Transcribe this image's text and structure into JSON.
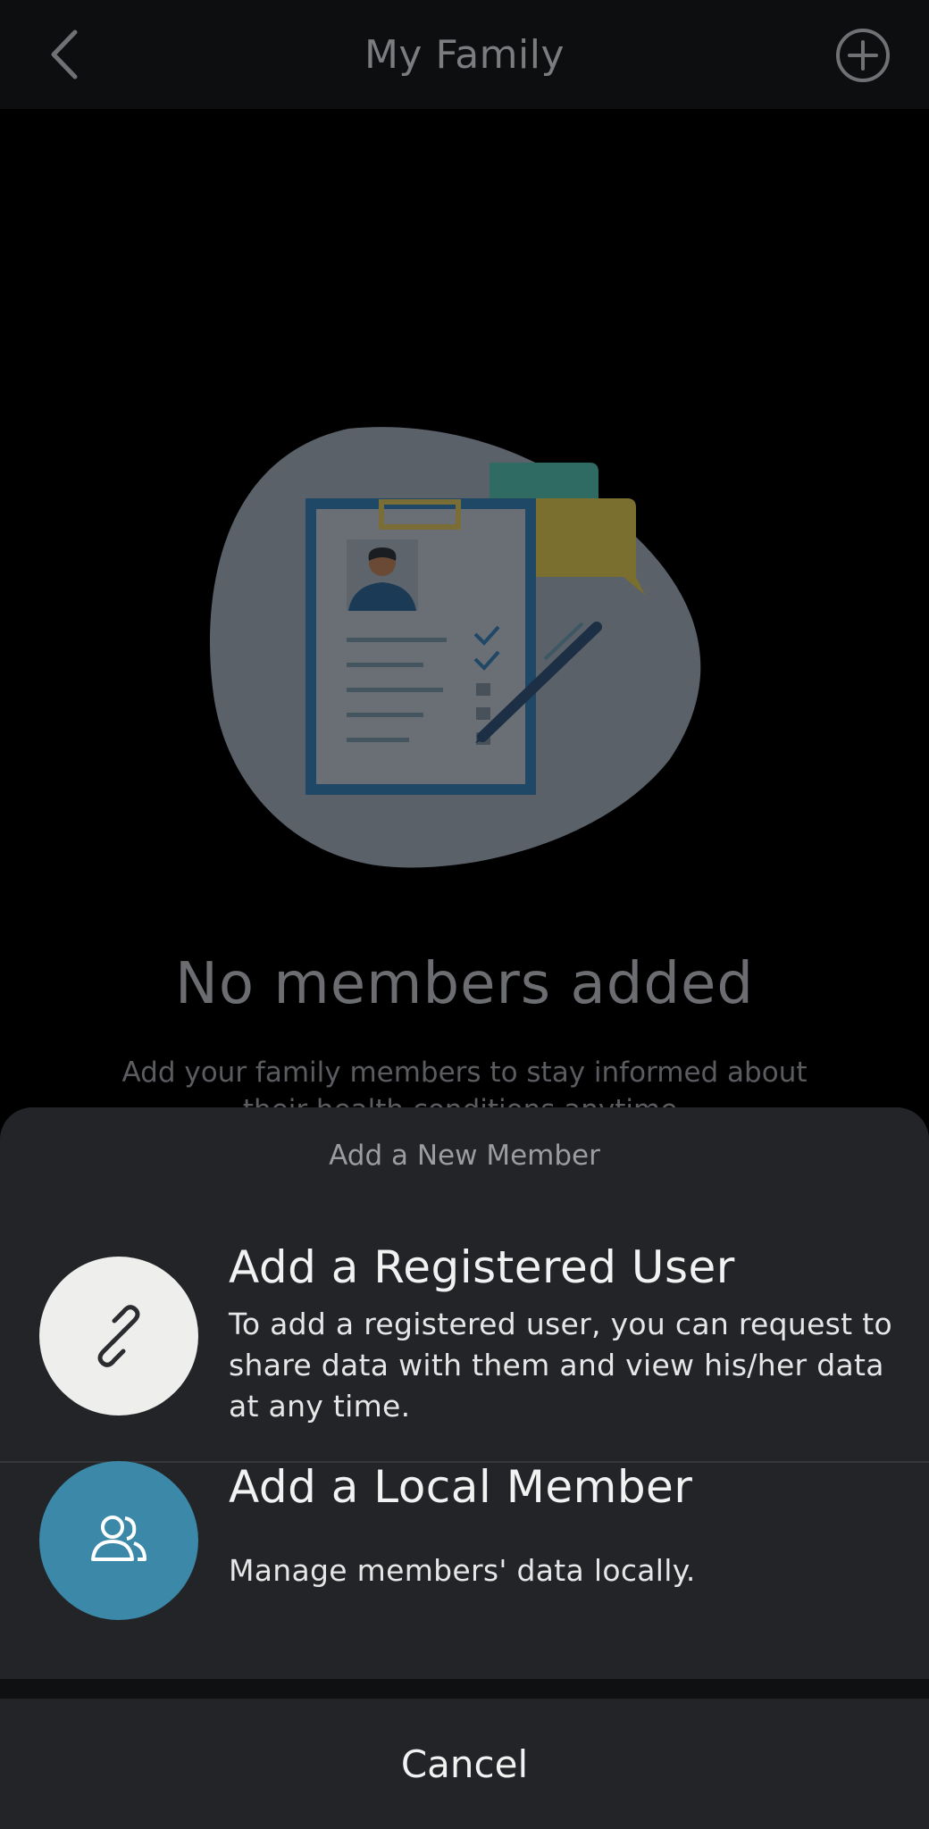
{
  "header": {
    "title": "My Family",
    "back_icon": "chevron-left-icon",
    "add_icon": "plus-circle-icon"
  },
  "empty_state": {
    "title": "No members added",
    "description": "Add your family members to stay informed about their health conditions anytime."
  },
  "sheet": {
    "title": "Add a New Member",
    "options": [
      {
        "icon": "link-icon",
        "title": "Add a Registered User",
        "description": "To add a registered user, you can request to share data with them and view his/her data at any time."
      },
      {
        "icon": "users-icon",
        "title": "Add a Local Member",
        "description": "Manage members' data locally."
      }
    ],
    "cancel_label": "Cancel"
  },
  "colors": {
    "accent": "#3b88a8",
    "sheet_bg": "#222428",
    "background": "#000000"
  }
}
